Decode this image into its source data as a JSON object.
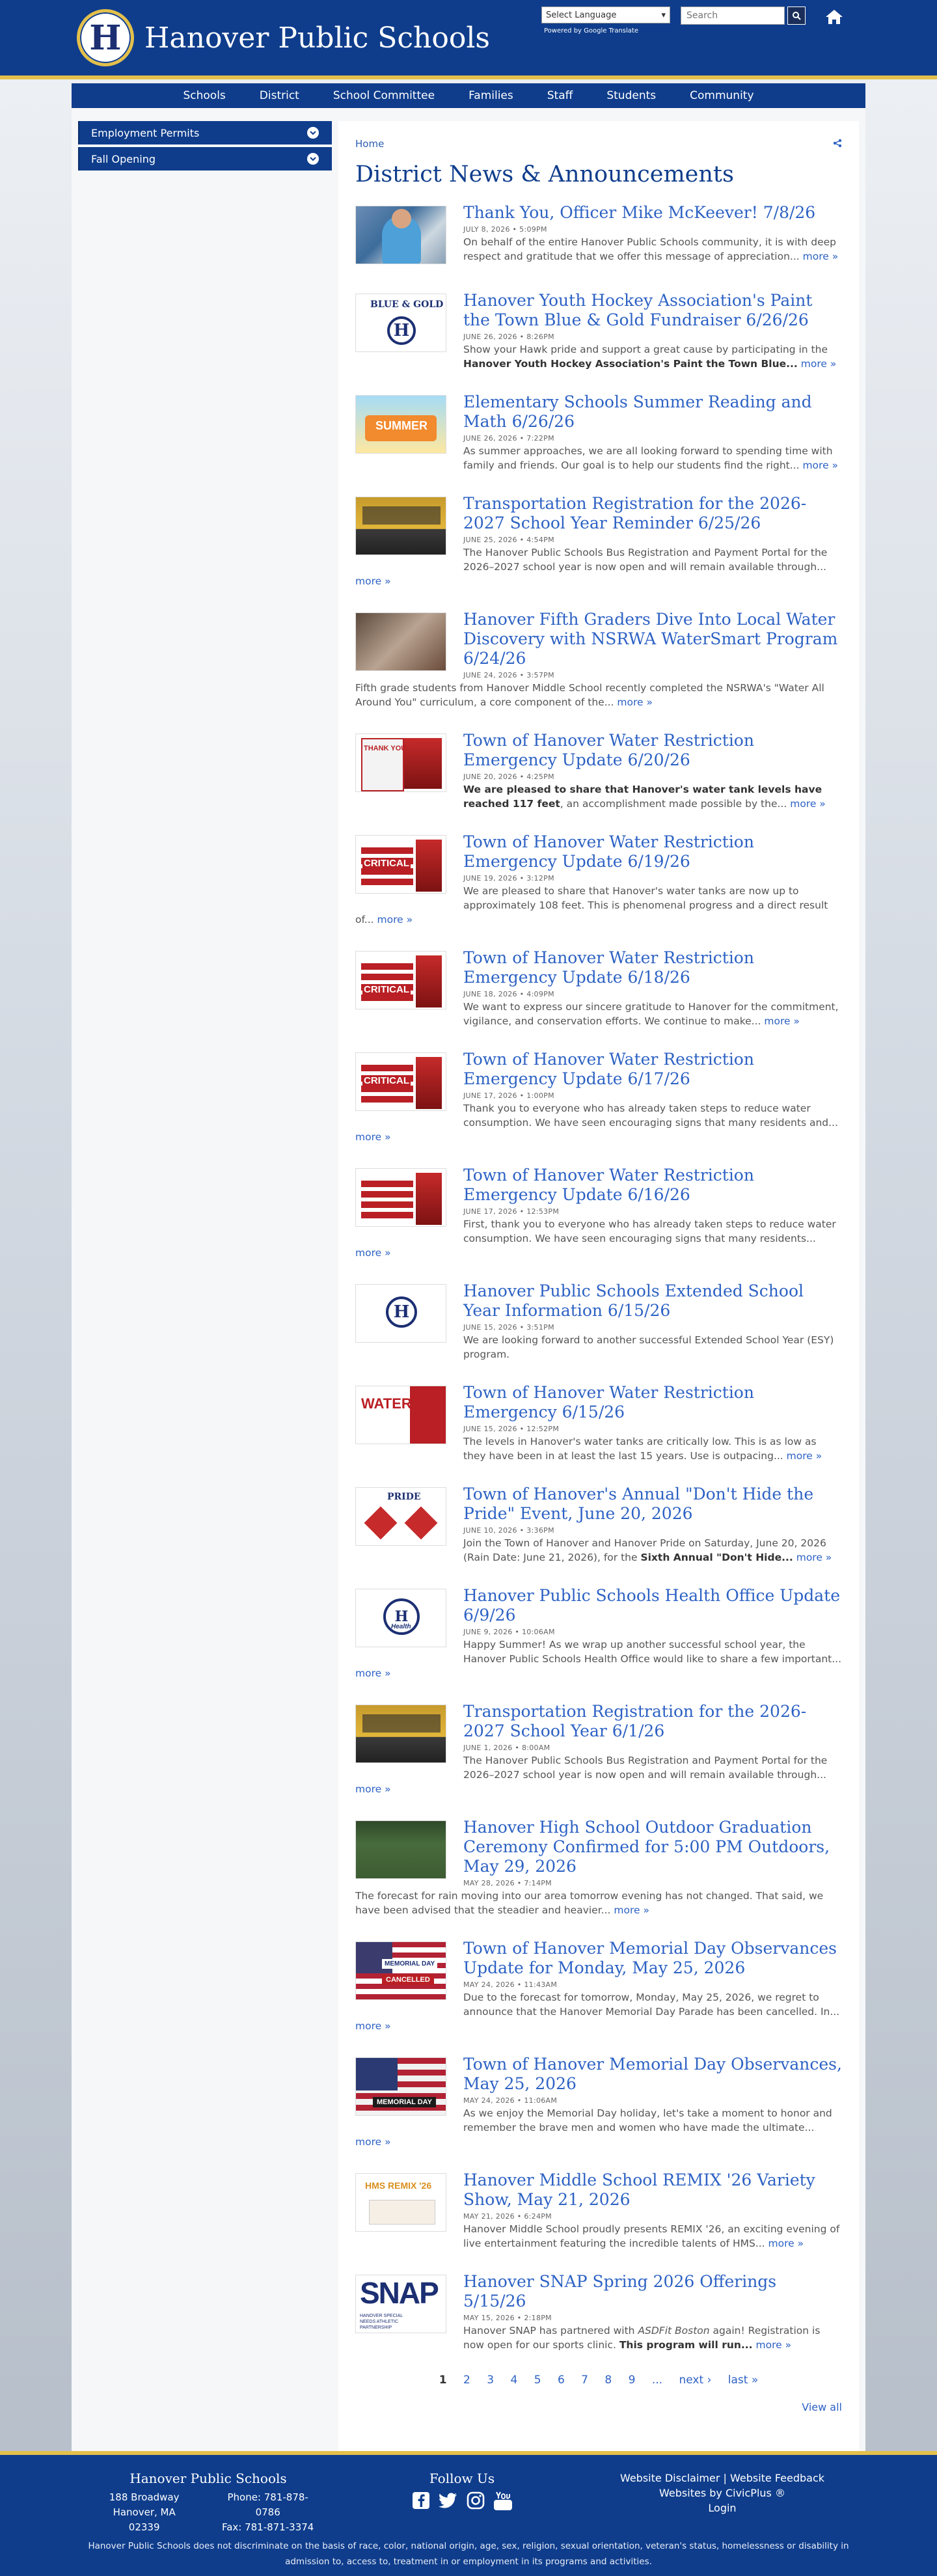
{
  "header": {
    "site_title": "Hanover Public Schools",
    "logo_letter": "H",
    "language_select": "Select Language",
    "powered_by": "Powered by Google Translate",
    "search_placeholder": "Search",
    "colors": {
      "primary": "#0f3d8c",
      "accent": "#e3c04b",
      "link": "#2d62c4"
    }
  },
  "nav": [
    "Schools",
    "District",
    "School Committee",
    "Families",
    "Staff",
    "Students",
    "Community"
  ],
  "sidebar": [
    "Employment Permits",
    "Fall Opening"
  ],
  "breadcrumb": "Home",
  "page_title": "District News & Announcements",
  "more_label": "more »",
  "news": [
    {
      "title": "Thank You, Officer Mike McKeever! 7/8/26",
      "date": "JULY 8, 2026 • 5:09PM",
      "text": "On behalf of the entire Hanover Public Schools community, it is with deep respect and gratitude that we offer this message of appreciation..."
    },
    {
      "title": "Hanover Youth Hockey Association's Paint the Town Blue & Gold Fundraiser 6/26/26",
      "date": "JUNE 26, 2026 • 8:26PM",
      "text": "Show your Hawk pride and support a great cause by participating in the ",
      "bold": "Hanover Youth Hockey Association's Paint the Town Blue..."
    },
    {
      "title": "Elementary Schools Summer Reading and Math 6/26/26",
      "date": "JUNE 26, 2026 • 7:22PM",
      "text": "As summer approaches, we are all looking forward to spending time with family and friends. Our goal is to help our students find the right..."
    },
    {
      "title": "Transportation Registration for the 2026-2027 School Year Reminder 6/25/26",
      "date": "JUNE 25, 2026 • 4:54PM",
      "text": "The Hanover Public Schools Bus Registration and Payment Portal for the 2026–2027 school year is now open and will remain available through..."
    },
    {
      "title": "Hanover Fifth Graders Dive Into Local Water Discovery with NSRWA WaterSmart Program 6/24/26",
      "date": "JUNE 24, 2026 • 3:57PM",
      "text": "Fifth grade students from Hanover Middle School recently completed the NSRWA's \"Water All Around You\" curriculum, a core component of the..."
    },
    {
      "title": "Town of Hanover Water Restriction Emergency Update 6/20/26",
      "date": "JUNE 20, 2026 • 4:25PM",
      "bold_first": "We are pleased to share that Hanover's water tank levels have reached 117 feet",
      "text": ", an accomplishment made possible by the..."
    },
    {
      "title": "Town of Hanover Water Restriction Emergency Update 6/19/26",
      "date": "JUNE 19, 2026 • 3:12PM",
      "text": "We are pleased to share that Hanover's water tanks are now up to approximately 108 feet. This is phenomenal progress and a direct result of..."
    },
    {
      "title": "Town of Hanover Water Restriction Emergency Update 6/18/26",
      "date": "JUNE 18, 2026 • 4:09PM",
      "text": "We want to express our sincere gratitude to Hanover for the commitment, vigilance, and conservation efforts. We continue to make..."
    },
    {
      "title": "Town of Hanover Water Restriction Emergency Update 6/17/26",
      "date": "JUNE 17, 2026 • 1:00PM",
      "text": "Thank you to everyone who has already taken steps to reduce water consumption. We have seen encouraging signs that many residents and..."
    },
    {
      "title": "Town of Hanover Water Restriction Emergency Update 6/16/26",
      "date": "JUNE 17, 2026 • 12:53PM",
      "text": "First, thank you to everyone who has already taken steps to reduce water consumption. We have seen encouraging signs that many residents..."
    },
    {
      "title": "Hanover Public Schools Extended School Year Information 6/15/26",
      "date": "JUNE 15, 2026 • 3:51PM",
      "text": "We are looking forward to another successful Extended School Year (ESY) program."
    },
    {
      "title": "Town of Hanover Water Restriction Emergency 6/15/26",
      "date": "JUNE 15, 2026 • 12:52PM",
      "text": "The levels in Hanover's water tanks are critically low. This is as low as they have been in at least the last 15 years. Use is outpacing..."
    },
    {
      "title": "Town of Hanover's Annual \"Don't Hide the Pride\" Event, June 20, 2026",
      "date": "JUNE 10, 2026 • 3:36PM",
      "text": "Join the Town of Hanover and Hanover Pride on Saturday, June 20, 2026 (Rain Date: June 21, 2026), for the ",
      "bold": "Sixth Annual \"Don't Hide..."
    },
    {
      "title": "Hanover Public Schools Health Office Update 6/9/26",
      "date": "JUNE 9, 2026 • 10:06AM",
      "text": "Happy Summer! As we wrap up another successful school year, the Hanover Public Schools Health Office would like to share a few important..."
    },
    {
      "title": "Transportation Registration for the 2026-2027 School Year 6/1/26",
      "date": "JUNE 1, 2026 • 8:00AM",
      "text": "The Hanover Public Schools Bus Registration and Payment Portal for the 2026–2027 school year is now open and will remain available through..."
    },
    {
      "title": "Hanover High School Outdoor Graduation Ceremony Confirmed for 5:00 PM Outdoors, May 29, 2026",
      "date": "MAY 28, 2026 • 7:14PM",
      "text": "The forecast for rain moving into our area tomorrow evening has not changed. That said, we have been advised that the steadier and heavier..."
    },
    {
      "title": "Town of Hanover Memorial Day Observances Update for Monday, May 25, 2026",
      "date": "MAY 24, 2026 • 11:43AM",
      "text": "Due to the forecast for tomorrow, Monday, May 25, 2026, we regret to announce that the Hanover Memorial Day Parade has been cancelled. In..."
    },
    {
      "title": "Town of Hanover Memorial Day Observances, May 25, 2026",
      "date": "MAY 24, 2026 • 11:06AM",
      "text": "As we enjoy the Memorial Day holiday, let's take a moment to honor and remember the brave men and women who have made the ultimate..."
    },
    {
      "title": "Hanover Middle School REMIX '26 Variety Show, May 21, 2026",
      "date": "MAY 21, 2026 • 6:24PM",
      "text": "Hanover Middle School proudly presents REMIX '26, an exciting evening of live entertainment featuring the incredible talents of HMS..."
    },
    {
      "title": "Hanover SNAP Spring 2026 Offerings 5/15/26",
      "date": "MAY 15, 2026 • 2:18PM",
      "text": "Hanover SNAP has partnered with ",
      "italic": "ASDFit Boston",
      "text2": " again! Registration is now open for our sports clinic. ",
      "bold": "This program will run..."
    }
  ],
  "thumb_labels": {
    "blue_gold": "BLUE & GOLD",
    "summer": "SUMMER",
    "thank_you": "THANK YOU",
    "critical": "CRITICAL",
    "water": "WATER",
    "pride": "PRIDE",
    "health": "Health",
    "memorial": "MEMORIAL DAY",
    "cancelled": "CANCELLED",
    "remix": "HMS REMIX '26",
    "snap": "SNAP",
    "snap_sub": "HANOVER SPECIAL NEEDS ATHLETIC PARTNERSHIP"
  },
  "pager": [
    "1",
    "2",
    "3",
    "4",
    "5",
    "6",
    "7",
    "8",
    "9",
    "...",
    "next ›",
    "last »"
  ],
  "view_all": "View all",
  "footer": {
    "name": "Hanover Public Schools",
    "address1": "188 Broadway",
    "address2": "Hanover, MA 02339",
    "phone": "Phone: 781-878-0786",
    "fax": "Fax: 781-871-3374",
    "follow": "Follow Us",
    "links1": "Website Disclaimer | Website Feedback",
    "links2": "Websites by CivicPlus ®",
    "links3": "Login",
    "disclaimer": "Hanover Public Schools does not discriminate on the basis of race, color, national origin, age, sex, religion, sexual orientation, veteran's status, homelessness or disability in admission to, access to, treatment in or employment in its programs and activities."
  }
}
